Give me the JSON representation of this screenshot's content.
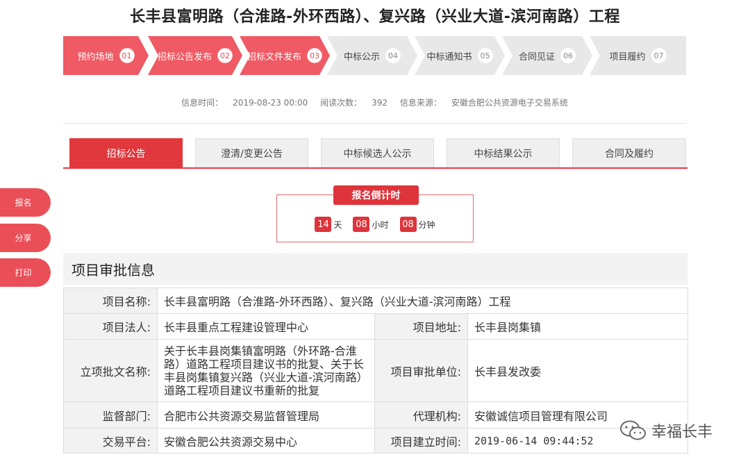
{
  "page": {
    "title": "长丰县富明路（合淮路-外环西路）、复兴路（兴业大道-滨河南路）工程"
  },
  "steps": [
    {
      "label": "预约场地",
      "num": "01",
      "active": true
    },
    {
      "label": "招标公告发布",
      "num": "02",
      "active": true
    },
    {
      "label": "招标文件发布",
      "num": "03",
      "active": true
    },
    {
      "label": "中标公示",
      "num": "04",
      "active": false
    },
    {
      "label": "中标通知书",
      "num": "05",
      "active": false
    },
    {
      "label": "合同见证",
      "num": "06",
      "active": false
    },
    {
      "label": "项目履约",
      "num": "07",
      "active": false
    }
  ],
  "meta": {
    "time_label": "信息时间：",
    "time_value": "2019-08-23 00:00",
    "views_label": "阅读次数：",
    "views_value": "392",
    "source_label": "信息来源：",
    "source_value": "安徽合肥公共资源电子交易系统"
  },
  "tabs": [
    {
      "label": "招标公告",
      "active": true
    },
    {
      "label": "澄清/变更公告",
      "active": false
    },
    {
      "label": "中标候选人公示",
      "active": false
    },
    {
      "label": "中标结果公示",
      "active": false
    },
    {
      "label": "合同及履约",
      "active": false
    }
  ],
  "countdown": {
    "title": "报名倒计时",
    "days": "14",
    "days_unit": "天",
    "hours": "08",
    "hours_unit": "小时",
    "minutes": "08",
    "minutes_unit": "分钟"
  },
  "side_buttons": {
    "signup": "报名",
    "share": "分享",
    "print": "打印"
  },
  "section": {
    "title": "项目审批信息"
  },
  "info": {
    "project_name_label": "项目名称:",
    "project_name": "长丰县富明路（合淮路-外环西路）、复兴路（兴业大道-滨河南路）工程",
    "legal_label": "项目法人:",
    "legal": "长丰县重点工程建设管理中心",
    "address_label": "项目地址:",
    "address": "长丰县岗集镇",
    "approval_doc_label": "立项批文名称:",
    "approval_doc": "关于长丰县岗集镇富明路（外环路-合淮路）道路工程项目建议书的批复、关于长丰县岗集镇复兴路（兴业大道-滨河南路）道路工程项目建议书重新的批复",
    "approval_unit_label": "项目审批单位:",
    "approval_unit": "长丰县发改委",
    "supervisor_label": "监督部门:",
    "supervisor": "合肥市公共资源交易监督管理局",
    "agency_label": "代理机构:",
    "agency": "安徽诚信项目管理有限公司",
    "platform_label": "交易平台:",
    "platform": "安徽合肥公共资源交易中心",
    "created_label": "项目建立时间:",
    "created": "2019-06-14 09:44:52"
  },
  "watermark": {
    "text": "幸福长丰"
  },
  "colors": {
    "accent": "#e0383d",
    "step_active": "#ef5a64",
    "step_inactive": "#e8e8e8"
  }
}
